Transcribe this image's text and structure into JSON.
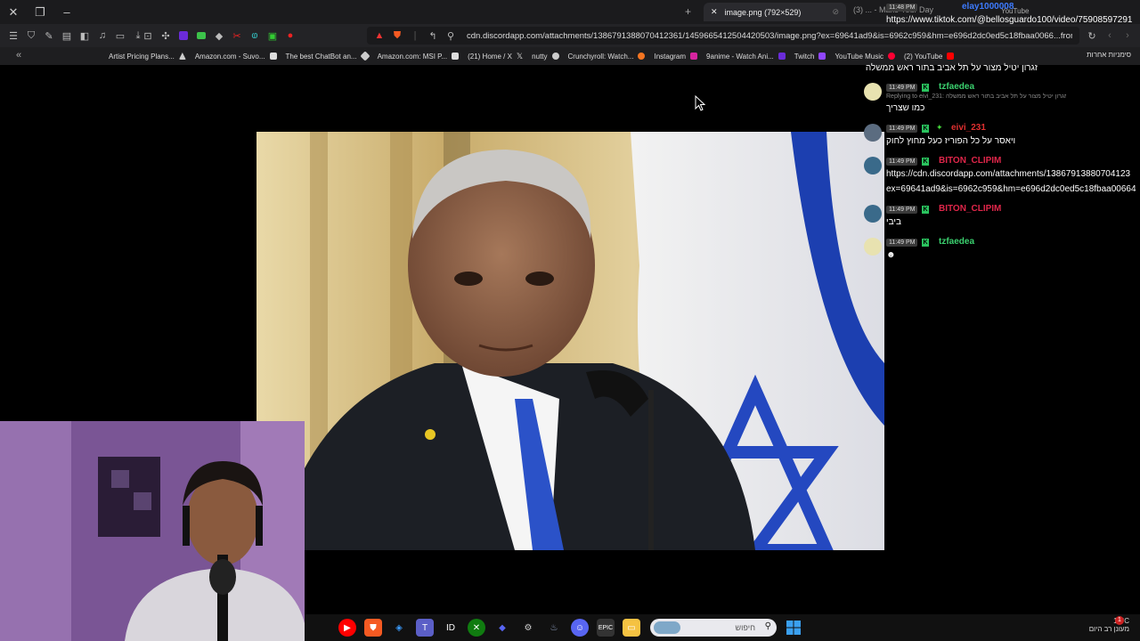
{
  "titlebar": {
    "active_tab_title": "image.png (792×529)",
    "ghost_tab_text": "(3) ... - Make Your Day",
    "tab_youtube": "YouTube"
  },
  "urlbar": {
    "url": "cdn.discordapp.com/attachments/1386791388070412361/1459665412504420503/image.png?ex=69641ad9&is=6962c959&hm=e696d2dc0ed5c18fbaa0066...from_webapp=1&sender_device=pc"
  },
  "bookmarks": {
    "items": [
      "Artist Pricing Plans...",
      "Amazon.com - Suvo...",
      "The best ChatBot an...",
      "Amazon.com: MSI P...",
      "(21) Home / X",
      "nutty",
      "Crunchyroll: Watch...",
      "Instagram",
      "9anime - Watch Ani...",
      "Twitch",
      "YouTube Music",
      "(2) YouTube"
    ],
    "other": "סימניות אחרות"
  },
  "overlay": {
    "time": "11:48 PM",
    "user": "elay1000008",
    "link": "https://www.tiktok.com/@bellosguardo100/video/75908597291"
  },
  "chat": {
    "top_text": "זגרון יטיל מצור על תל אביב בתור ראש ממשלה",
    "messages": [
      {
        "time": "11:49 PM",
        "user": "tzfaedea",
        "user_color": "#3bd16f",
        "reply": "Replying to eivi_231: זגרון יטיל מצור על תל אביב בתור ראש ממשלה",
        "text": "כמו שצריך"
      },
      {
        "time": "11:49 PM",
        "user": "eivi_231",
        "user_color": "#e03030",
        "reply": "",
        "text": "ויאסר על כל הפוריז כעל מחוץ לחוק"
      },
      {
        "time": "11:49 PM",
        "user": "BITON_CLIPIM",
        "user_color": "#e0264a",
        "reply": "",
        "text": "https://cdn.discordapp.com/attachments/13867913880704123",
        "text2": "ex=69641ad9&is=6962c959&hm=e696d2dc0ed5c18fbaa00664"
      },
      {
        "time": "11:49 PM",
        "user": "BITON_CLIPIM",
        "user_color": "#e0264a",
        "reply": "",
        "text": "ביבי"
      },
      {
        "time": "11:49 PM",
        "user": "tzfaedea",
        "user_color": "#3bd16f",
        "reply": "",
        "text": ""
      }
    ]
  },
  "taskbar": {
    "search_placeholder": "חיפוש",
    "temperature": "13°C",
    "weather": "מעונן רב היום",
    "notification_count": "1"
  }
}
